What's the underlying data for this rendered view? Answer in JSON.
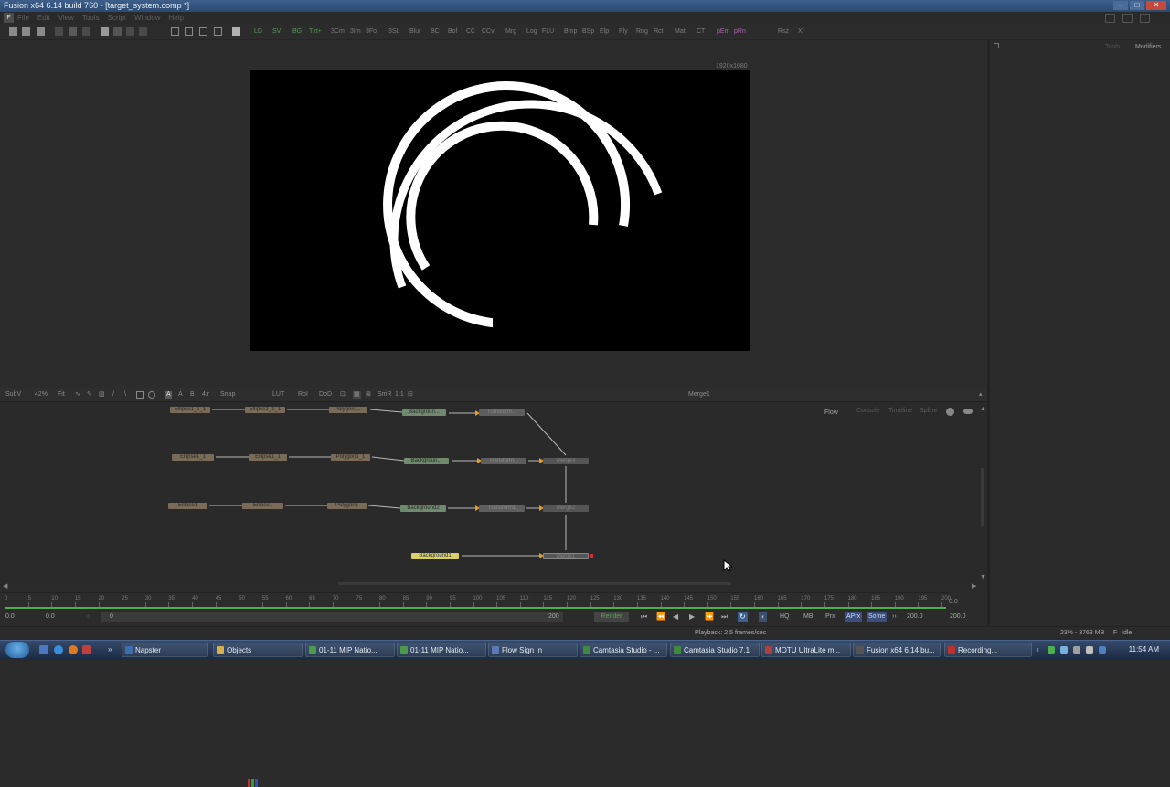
{
  "window": {
    "title": "Fusion x64 6.14 build 760 - [target_system.comp *]"
  },
  "menu": [
    "File",
    "Edit",
    "View",
    "Tools",
    "Script",
    "Window",
    "Help"
  ],
  "toolbar": {
    "tools": [
      "LD",
      "SV",
      "BG",
      "Txt+",
      "3Cm",
      "3Im",
      "3Fo",
      "3SL",
      "Blur",
      "BC",
      "Bol",
      "CC",
      "CCv",
      "Mrg",
      "Log",
      "FLU",
      "Bmp",
      "BSp",
      "Elp",
      "Ply",
      "Rng",
      "Rct",
      "Mat",
      "CT",
      "pEm",
      "pRn",
      "Rsz",
      "Xf"
    ]
  },
  "viewer": {
    "resolution": "1920x1080"
  },
  "right_panel": {
    "tabs": [
      "Tools",
      "Modifiers"
    ]
  },
  "view_toolbar": {
    "subv": "SubV",
    "zoom": "42%",
    "fit": "Fit",
    "text_a": "A",
    "text_b": "B",
    "roi": "4:r",
    "snap": "Snap",
    "lut": "LUT",
    "roi2": "RoI",
    "dod": "DoD",
    "smr": "SmR",
    "ratio": "1:1",
    "active_tool": "Merge1"
  },
  "flow": {
    "tabs": [
      "Flow",
      "Console",
      "Timeline",
      "Spline"
    ],
    "rows": [
      {
        "mask1": "Ellipse1_1_1",
        "mask2": "Ellipse1_1_1",
        "poly": "Polygon1...",
        "bg": "Backgroun...",
        "xf": "Transform..."
      },
      {
        "mask1": "Ellipse1_1",
        "mask2": "Ellipse1_1",
        "poly": "Polygon1_1",
        "bg": "Backgroun...",
        "xf": "Transform...",
        "mg": "Merge3"
      },
      {
        "mask1": "Ellipse1",
        "mask2": "Ellipse1",
        "poly": "Polygon1",
        "bg": "Background2",
        "xf": "Transform1",
        "mg": "Merge2"
      }
    ],
    "bottom_bg": "Background1",
    "bottom_merge": "Merge1"
  },
  "timeline": {
    "ticks": [
      "0",
      "5",
      "10",
      "15",
      "20",
      "25",
      "30",
      "35",
      "40",
      "45",
      "50",
      "55",
      "60",
      "65",
      "70",
      "75",
      "80",
      "85",
      "90",
      "95",
      "100",
      "105",
      "110",
      "115",
      "120",
      "125",
      "130",
      "135",
      "140",
      "145",
      "150",
      "155",
      "160",
      "165",
      "170",
      "175",
      "180",
      "185",
      "190",
      "195",
      "200"
    ],
    "end_value": "0.0",
    "start_time": "0.0",
    "render_start": "0.0",
    "range_start": "0",
    "range_end": "200",
    "render_label": "Render",
    "hq": "HQ",
    "mb": "MB",
    "prx": "Prx",
    "aprx": "APrx",
    "some": "Some",
    "current": "200.0",
    "global_end": "200.0"
  },
  "status": {
    "playback": "Playback: 2.5 frames/sec",
    "memory": "23% - 3763 MB",
    "state": "Idle"
  },
  "taskbar": {
    "items": [
      "Napster",
      "Objects",
      "01-11 MIP Natio...",
      "01-11 MIP Natio...",
      "Flow Sign In",
      "Camtasia Studio - ...",
      "Camtasia Studio 7.1",
      "MOTU UltraLite m...",
      "Fusion x64 6.14 bu...",
      "Recording..."
    ],
    "clock": "11:54 AM"
  },
  "colors": {
    "accent": "#d9d06a",
    "mask": "#7a6a58",
    "background_node": "#6f8a6c",
    "render_green": "#5aa05a"
  }
}
